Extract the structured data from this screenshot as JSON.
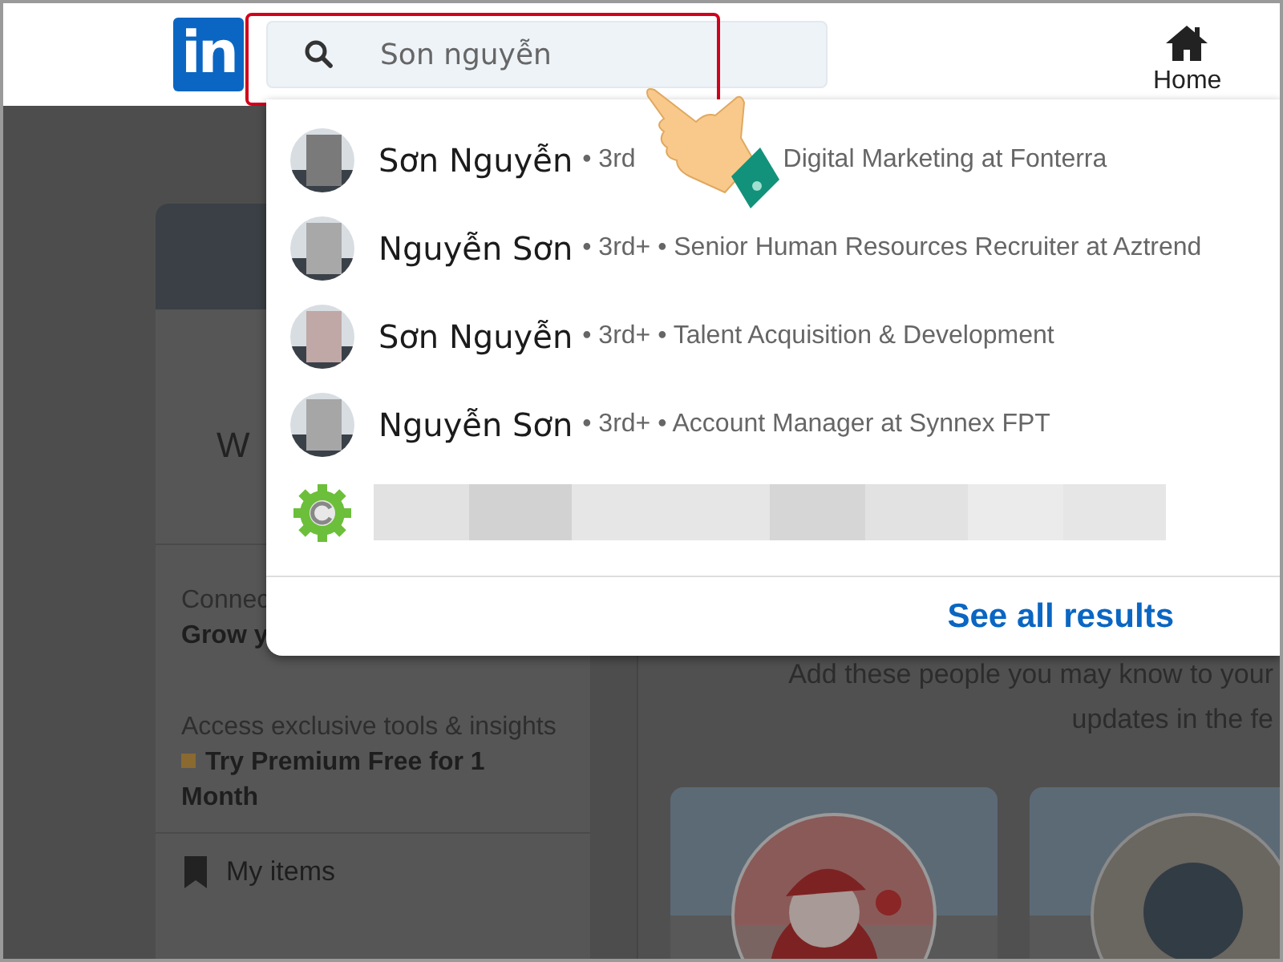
{
  "header": {
    "logo": "in",
    "search": {
      "value": "Son nguyễn",
      "highlighted": true
    },
    "nav": [
      {
        "label": "Home"
      }
    ]
  },
  "search_results": {
    "items": [
      {
        "kind": "person",
        "name": "Sơn Nguyễn",
        "details": [
          "• 3rd",
          "Digital Marketing at Fonterra"
        ]
      },
      {
        "kind": "person",
        "name": "Nguyễn Sơn",
        "details": [
          "• 3rd+ • Senior Human Resources Recruiter at Aztrend"
        ]
      },
      {
        "kind": "person",
        "name": "Sơn Nguyễn",
        "details": [
          "• 3rd+ • Talent Acquisition & Development"
        ]
      },
      {
        "kind": "person",
        "name": "Nguyễn Sơn",
        "details": [
          "• 3rd+ • Account Manager at Synnex FPT"
        ]
      },
      {
        "kind": "company"
      }
    ],
    "footer_link": "See all results"
  },
  "profile_card": {
    "greeting": "W",
    "connections_label": "Connec",
    "connections_cta": "Grow y",
    "premium_text": "Access exclusive tools & insights",
    "premium_link": "Try Premium Free for 1 Month",
    "saved_items": "My items"
  },
  "suggestions": {
    "lines": [
      "Add these people you may know to your",
      "updates in the fe"
    ],
    "cards": [
      {
        "kind": "picture"
      },
      {
        "kind": "placeholder"
      }
    ]
  }
}
